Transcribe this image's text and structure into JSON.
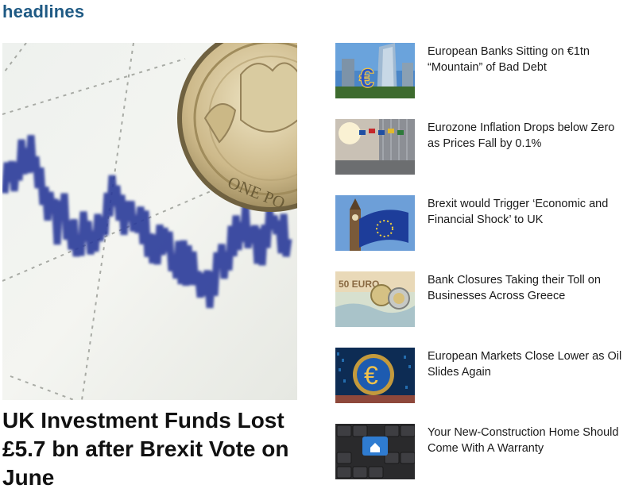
{
  "section": {
    "title": "headlines"
  },
  "feature": {
    "title": "UK Investment Funds Lost £5.7 bn after Brexit Vote on June",
    "image": "pound-coin-on-stock-chart",
    "coin_text": "ONE PO"
  },
  "headlines": [
    {
      "title": "European Banks Sitting on €1tn “Mountain” of Bad Debt",
      "image": "euro-sign-bank-towers"
    },
    {
      "title": "Eurozone Inflation Drops below Zero as Prices Fall by 0.1%",
      "image": "eu-flags-building"
    },
    {
      "title": "Brexit would Trigger ‘Economic and Financial Shock’ to UK",
      "image": "big-ben-eu-flag"
    },
    {
      "title": "Bank Closures Taking their Toll on Businesses Across Greece",
      "image": "euro-coins-banknote-map",
      "banknote_text": "50 EURO"
    },
    {
      "title": "European Markets Close Lower as Oil Slides Again",
      "image": "euro-coin-digital-screen",
      "symbol": "€"
    },
    {
      "title": "Your New-Construction Home Should Come With A Warranty",
      "image": "keyboard-house-key"
    }
  ],
  "colors": {
    "title": "#1f5a84",
    "text": "#1a1a1a",
    "chart": "#2c3b9a"
  }
}
